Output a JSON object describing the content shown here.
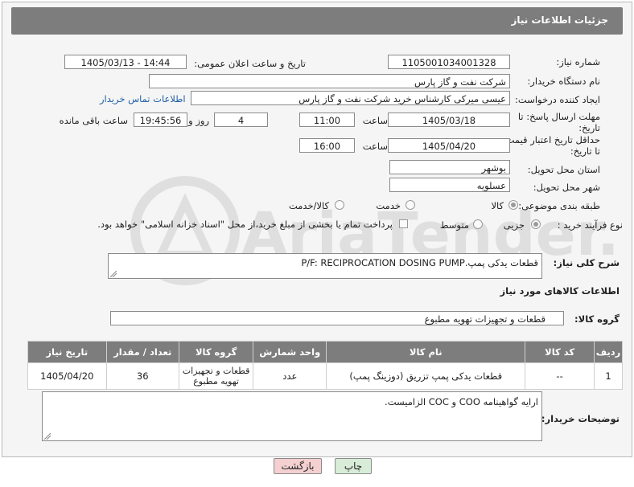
{
  "title": "جزئیات اطلاعات نیاز",
  "fields": {
    "need_number_label": "شماره نیاز:",
    "need_number": "1105001034001328",
    "announce_label": "تاریخ و ساعت اعلان عمومی:",
    "announce_value": "1405/03/13 - 14:44",
    "buyer_label": "نام دستگاه خریدار:",
    "buyer_value": "شرکت نفت و گاز پارس",
    "creator_label": "ایجاد کننده درخواست:",
    "creator_value": "عیسی میرکی کارشناس خرید شرکت نفت و گاز پارس",
    "contact_link": "اطلاعات تماس خریدار",
    "deadline_label": "مهلت ارسال پاسخ: تا تاریخ:",
    "deadline_date": "1405/03/18",
    "time_label": "ساعت",
    "deadline_time": "11:00",
    "days_value": "4",
    "days_label": "روز و",
    "remaining_time": "19:45:56",
    "remaining_label": "ساعت باقی مانده",
    "validity_label": "حداقل تاریخ اعتبار قیمت: تا تاریخ:",
    "validity_date": "1405/04/20",
    "validity_time": "16:00",
    "province_label": "استان محل تحویل:",
    "province_value": "بوشهر",
    "city_label": "شهر محل تحویل:",
    "city_value": "عسلویه",
    "category_label": "طبقه بندی موضوعی:",
    "category_options": [
      "کالا",
      "خدمت",
      "کالا/خدمت"
    ],
    "process_label": "نوع فرآیند خرید :",
    "process_options": [
      "جزیی",
      "متوسط"
    ],
    "payment_note": "پرداخت تمام یا بخشی از مبلغ خرید،از محل \"اسناد خزانه اسلامی\" خواهد بود.",
    "summary_label": "شرح کلی نیاز:",
    "summary_value": "قطعات یدکی پمپ.P/F: RECIPROCATION DOSING PUMP",
    "goods_info_label": "اطلاعات کالاهای مورد نیاز",
    "goods_group_label": "گروه کالا:",
    "goods_group_value": "قطعات و تجهیزات تهویه مطبوع"
  },
  "table": {
    "headers": [
      "ردیف",
      "کد کالا",
      "نام کالا",
      "واحد شمارش",
      "گروه کالا",
      "تعداد / مقدار",
      "تاریخ نیاز"
    ],
    "row": [
      "1",
      "--",
      "قطعات یدکی پمپ تزریق (دوزینگ پمپ)",
      "عدد",
      "قطعات و تجهیزات تهویه مطبوع",
      "36",
      "1405/04/20"
    ]
  },
  "notes_label": "توضیحات خریدار:",
  "notes_value": "ارایه گواهینامه COO  و COC الزامیست.",
  "buttons": {
    "print": "چاپ",
    "back": "بازگشت"
  },
  "watermark": "AriaTender.neT",
  "colors": {
    "header_bg": "#7d7d7d",
    "link": "#1f5fa8",
    "back_button": "#f4d0d0",
    "print_button": "#d8ecd8"
  }
}
